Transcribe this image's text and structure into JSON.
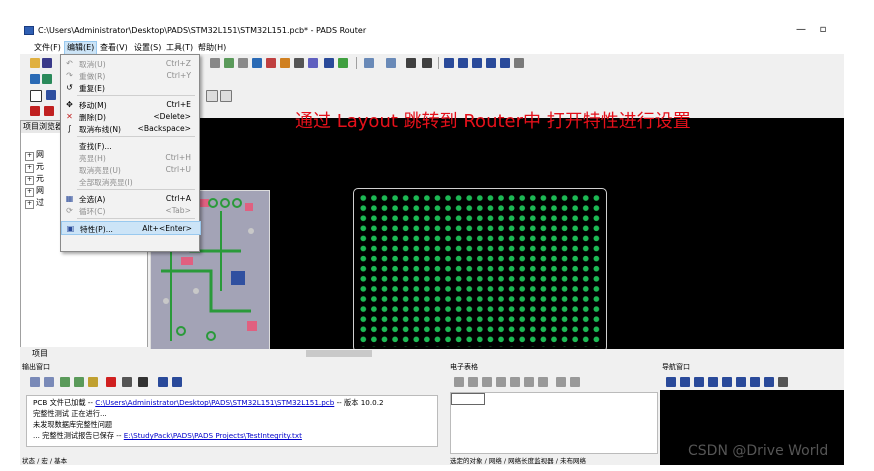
{
  "window": {
    "title": "C:\\Users\\Administrator\\Desktop\\PADS\\STM32L151\\STM32L151.pcb* - PADS Router",
    "minimize": "—",
    "restore": "▫"
  },
  "menubar": {
    "items": [
      "文件(F)",
      "编辑(E)",
      "查看(V)",
      "设置(S)",
      "工具(T)",
      "帮助(H)"
    ]
  },
  "edit_menu": {
    "items": [
      {
        "label": "取消(U)",
        "shortcut": "Ctrl+Z",
        "disabled": true,
        "icon": "undo-icon"
      },
      {
        "label": "重做(R)",
        "shortcut": "Ctrl+Y",
        "disabled": true,
        "icon": "redo-icon"
      },
      {
        "label": "重复(E)",
        "shortcut": "",
        "disabled": false,
        "icon": "repeat-icon"
      },
      {
        "label": "移动(M)",
        "shortcut": "Ctrl+E",
        "disabled": false,
        "icon": "move-icon"
      },
      {
        "label": "删除(D)",
        "shortcut": "<Delete>",
        "disabled": false,
        "icon": "delete-icon"
      },
      {
        "label": "取消布线(N)",
        "shortcut": "<Backspace>",
        "disabled": false,
        "icon": "unroute-icon"
      },
      {
        "label": "查找(F)...",
        "shortcut": "",
        "disabled": false,
        "icon": ""
      },
      {
        "label": "亮显(H)",
        "shortcut": "Ctrl+H",
        "disabled": true,
        "icon": ""
      },
      {
        "label": "取消亮显(U)",
        "shortcut": "Ctrl+U",
        "disabled": true,
        "icon": ""
      },
      {
        "label": "全部取消亮显(I)",
        "shortcut": "",
        "disabled": true,
        "icon": ""
      },
      {
        "label": "全选(A)",
        "shortcut": "Ctrl+A",
        "disabled": false,
        "icon": "select-all-icon"
      },
      {
        "label": "循环(C)",
        "shortcut": "<Tab>",
        "disabled": true,
        "icon": "cycle-icon"
      },
      {
        "label": "特性(P)...",
        "shortcut": "Alt+<Enter>",
        "disabled": false,
        "icon": "properties-icon"
      }
    ]
  },
  "project_panel": {
    "title": "项目浏览器",
    "tree": [
      "网",
      "元",
      "元",
      "网",
      "过"
    ],
    "tab": "项目"
  },
  "annotation": "通过 Layout 跳转到 Router中 打开特性进行设置",
  "output_window": {
    "title": "输出窗口",
    "lines": [
      {
        "text": "PCB 文件已加载 -- ",
        "link": "C:\\Users\\Administrator\\Desktop\\PADS\\STM32L151\\STM32L151.pcb",
        "suffix": " -- 版本  10.0.2"
      },
      {
        "text": "完整性测试 正在进行...",
        "link": "",
        "suffix": ""
      },
      {
        "text": "未发现数据库完整性问题",
        "link": "",
        "suffix": ""
      },
      {
        "text": "... 完整性测试报告已保存 -- ",
        "link": "E:\\StudyPack\\PADS\\PADS Projects\\TestIntegrity.txt",
        "suffix": ""
      }
    ],
    "tabs": "状态  /  宏  /  基本"
  },
  "spreadsheet": {
    "title": "电子表格",
    "tabs": "选定的对象  /  网络  /  网络长度监视器  /  未布网络"
  },
  "navigator": {
    "title": "导航窗口"
  },
  "watermark": "CSDN @Drive World",
  "colors": {
    "accent": "#e4101a",
    "pad_green": "#1db954",
    "canvas": "#000000",
    "menu_highlight": "#cce4f7"
  }
}
